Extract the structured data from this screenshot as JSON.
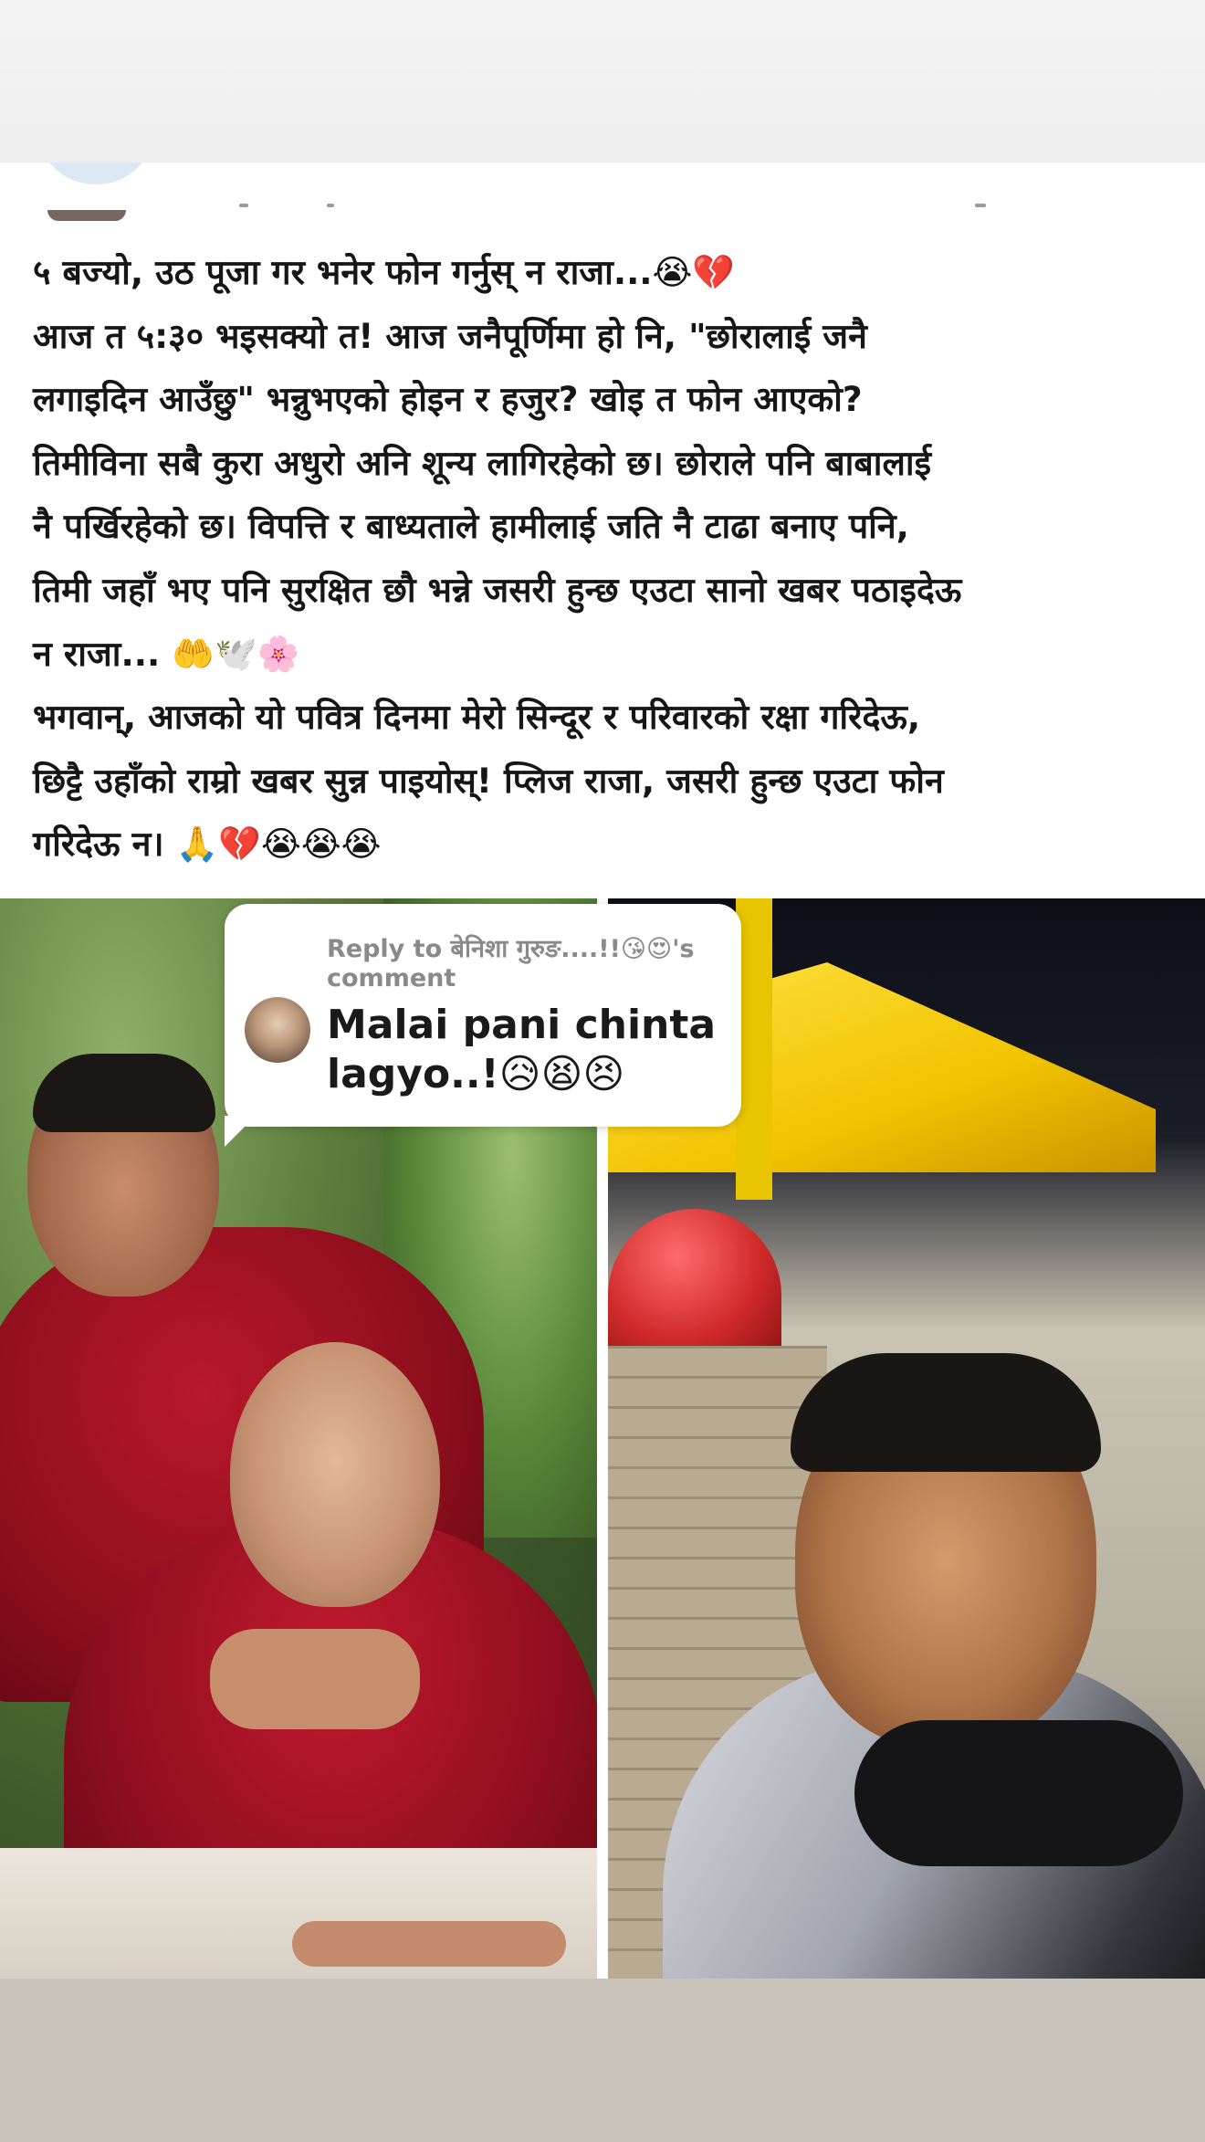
{
  "post": {
    "text_lines": [
      "५ बज्यो, उठ पूजा गर भनेर फोन गर्नुस् न राजा...😭💔",
      "आज त ५:३० भइसक्यो त! आज जनैपूर्णिमा हो नि, \"छोरालाई जनै",
      "लगाइदिन आउँछु\" भन्नुभएको होइन र हजुर? खोइ त फोन आएको?",
      "तिमीविना सबै कुरा अधुरो अनि शून्य लागिरहेको छ। छोराले पनि बाबालाई",
      "नै पर्खिरहेको छ। विपत्ति र बाध्यताले हामीलाई जति नै टाढा बनाए पनि,",
      "तिमी जहाँ भए पनि सुरक्षित छौ भन्ने जसरी हुन्छ एउटा सानो खबर पठाइदेऊ",
      "न राजा... 🤲🕊️🌸",
      "भगवान्, आजको यो पवित्र दिनमा मेरो सिन्दूर र परिवारको रक्षा गरिदेऊ,",
      "छिट्टै उहाँको राम्रो खबर सुन्न पाइयोस्! प्लिज राजा, जसरी हुन्छ एउटा फोन",
      "गरिदेऊ न। 🙏💔😭😭😭"
    ]
  },
  "reply": {
    "prefix": "Reply to ",
    "name": "बेनिशा गुरुङ....!!😘😍",
    "suffix": "'s comment",
    "comment": "Malai pani chinta lagyo..!😥😫😣"
  },
  "images": {
    "left": "photo-father-and-son",
    "right": "photo-man-at-temple"
  }
}
